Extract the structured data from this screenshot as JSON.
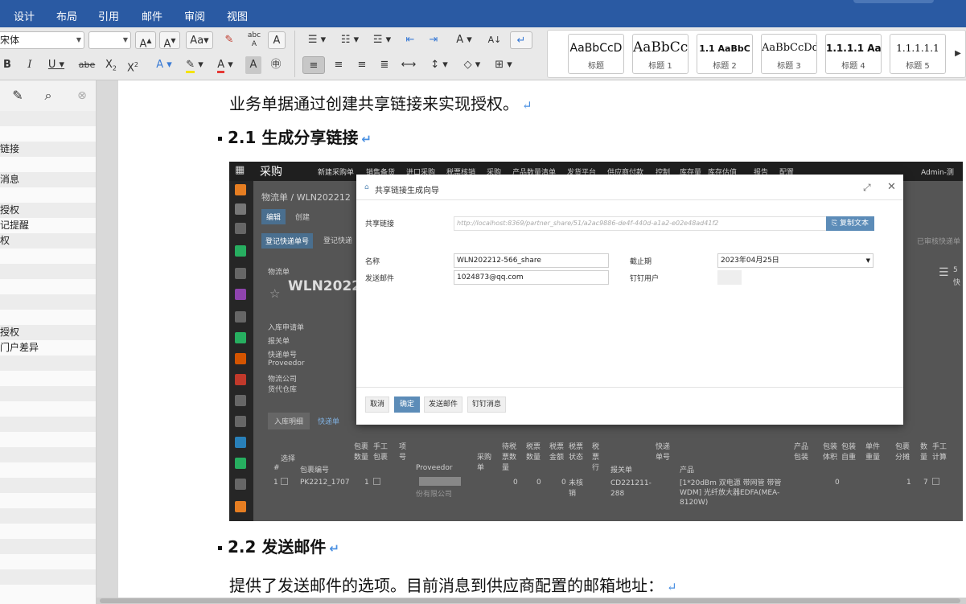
{
  "menu": [
    "设计",
    "布局",
    "引用",
    "邮件",
    "审阅",
    "视图"
  ],
  "toolbar": {
    "font_name": "宋体",
    "font_size": "",
    "style_gallery": [
      {
        "preview": "AaBbCcD",
        "name": "标题"
      },
      {
        "preview": "AaBbCc",
        "name": "标题 1"
      },
      {
        "preview": "1.1 AaBbC",
        "name": "标题 2"
      },
      {
        "preview": "AaBbCcDd",
        "name": "标题 3"
      },
      {
        "preview": "1.1.1.1 Aa",
        "name": "标题 4"
      },
      {
        "preview": "1.1.1.1.1",
        "name": "标题 5"
      }
    ]
  },
  "sidebar": {
    "items": [
      "链接",
      "消息",
      "授权",
      "记提醒",
      "权",
      "授权",
      "门户差异"
    ]
  },
  "document": {
    "para1": "业务单据通过创建共享链接来实现授权。",
    "h21": "2.1 生成分享链接",
    "h22": "2.2 发送邮件",
    "para2": "提供了发送邮件的选项。目前消息到供应商配置的邮箱地址："
  },
  "embedded": {
    "app_name": "采购",
    "nav": [
      "新建采购单",
      "销售备货",
      "进口采购",
      "税票核销",
      "采购",
      "产品数量清单",
      "发货平台",
      "供应商付款",
      "控制",
      "库存量",
      "库存估值",
      "报告",
      "配置"
    ],
    "user": "Admin-测",
    "breadcrumb": "物流单 / WLN202212",
    "edit": "编辑",
    "create": "创建",
    "action_btn": "登记快递单号",
    "action2": "登记快递",
    "status": "已审核快递单",
    "record_label": "物流单",
    "record_title": "WLN2022",
    "fields": [
      "入库申请单",
      "报关单",
      "快递单号",
      "Proveedor",
      "物流公司",
      "货代仓库"
    ],
    "tabs": [
      "入库明细",
      "快递单"
    ],
    "side_count": "5",
    "side_label": "快",
    "table_headers": [
      "选择",
      "包裹编号",
      "包裹数量",
      "手工包裹",
      "项号",
      "Proveedor",
      "采购单",
      "待税票数量",
      "税票数量",
      "税票金额",
      "税票状态",
      "税票行",
      "报关单",
      "快递单号",
      "产品",
      "产品包装",
      "包装体积",
      "包装自重",
      "单件重量",
      "包裹分摊",
      "数量",
      "手工计算"
    ],
    "row": {
      "num": "1",
      "pkg": "PK2212_1707",
      "qty": "1",
      "supplier": "份有限公司",
      "v1": "0",
      "v2": "0",
      "v3": "0",
      "state": "未核销",
      "customs": "CD221211-288",
      "product": "[1*20dBm 双电源 带网管 带管 WDM] 光纤放大器EDFA(MEA-8120W)",
      "vol": "0",
      "share": "1",
      "count": "7"
    },
    "modal": {
      "title": "共享链接生成向导",
      "share_label": "共享链接",
      "share_url": "http://localhost:8369/partner_share/51/a2ac9886-de4f-440d-a1a2-e02e48ad41f2",
      "copy": "复制文本",
      "name_label": "名称",
      "name_value": "WLN202212-566_share",
      "email_label": "发送邮件",
      "email_value": "1024873@qq.com",
      "deadline_label": "截止期",
      "deadline_value": "2023年04月25日",
      "ding_label": "钉钉用户",
      "btn_cancel": "取消",
      "btn_ok": "确定",
      "btn_mail": "发送邮件",
      "btn_ding": "钉钉消息"
    }
  }
}
